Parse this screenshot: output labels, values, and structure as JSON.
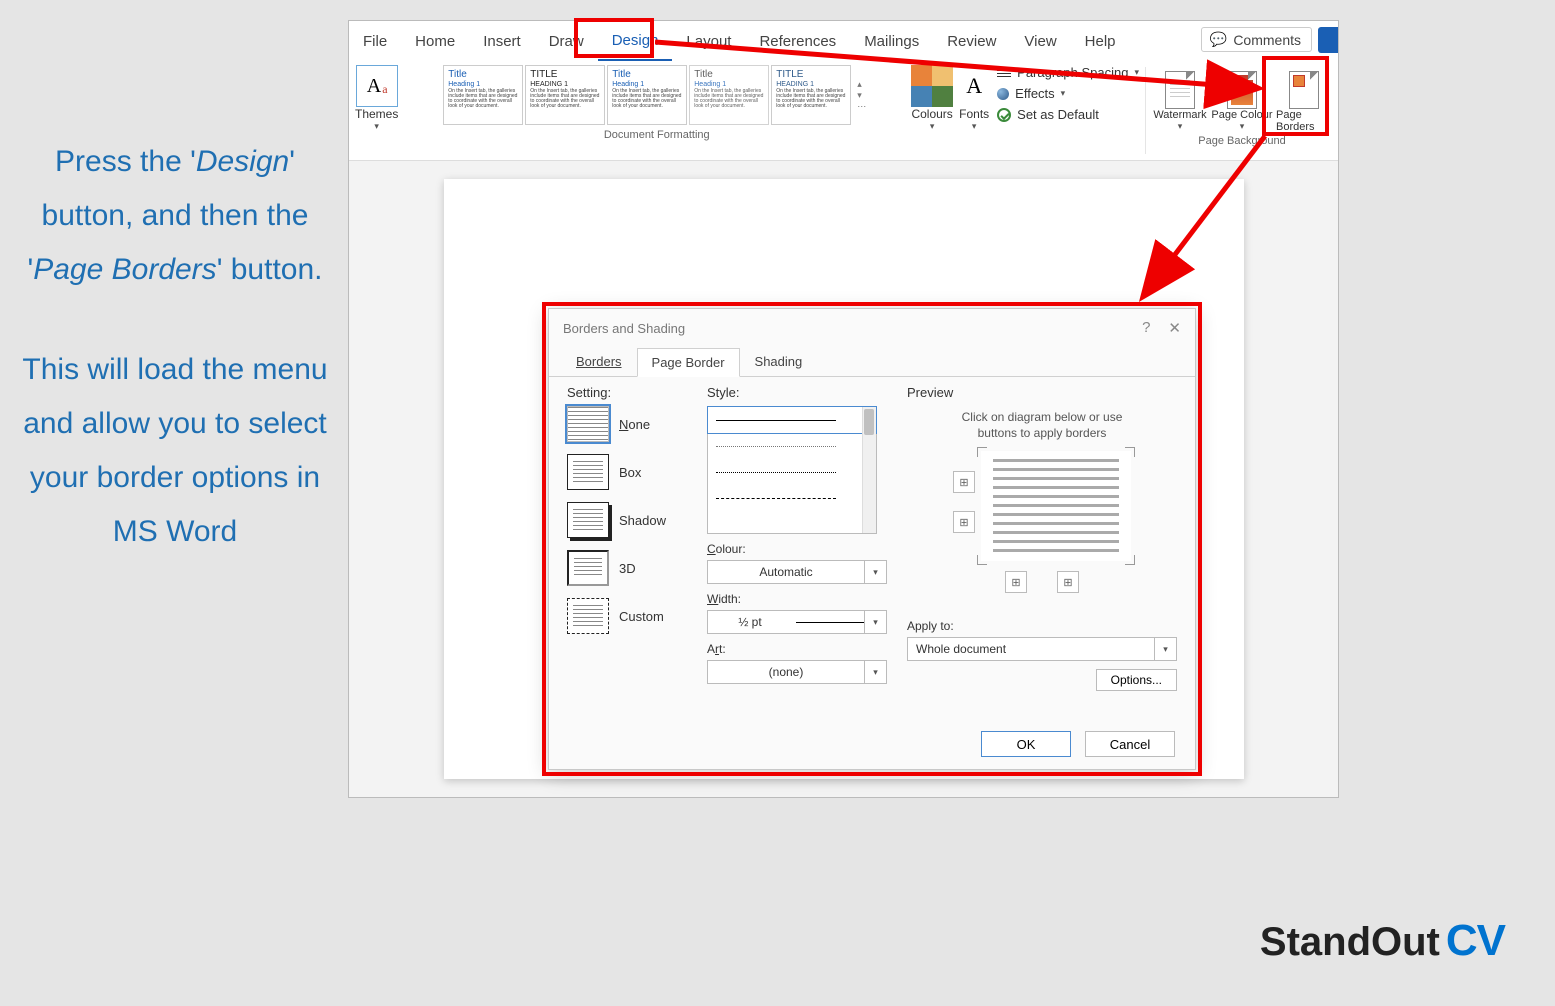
{
  "instructions": {
    "line1_pre": "Press the '",
    "line1_italic": "Design",
    "line1_post": "' button, and then the '",
    "line2_italic": "Page Borders",
    "line2_post": "' button.",
    "para2": "This will load the menu and allow you to select your border options in MS Word"
  },
  "tabs": [
    "File",
    "Home",
    "Insert",
    "Draw",
    "Design",
    "Layout",
    "References",
    "Mailings",
    "Review",
    "View",
    "Help"
  ],
  "active_tab": "Design",
  "comments": "Comments",
  "ribbon": {
    "themes": "Themes",
    "doc_formatting": "Document Formatting",
    "page_background": "Page Background",
    "preview_title": "Title",
    "preview_heading": "Heading 1",
    "preview_body": "On the Insert tab, the galleries include items that are designed to coordinate with the overall look of your document.",
    "colours": "Colours",
    "fonts": "Fonts",
    "para_spacing": "Paragraph Spacing",
    "effects": "Effects",
    "set_default": "Set as Default",
    "watermark": "Watermark",
    "page_colour": "Page Colour",
    "page_borders": "Page Borders"
  },
  "dialog": {
    "title": "Borders and Shading",
    "tabs": [
      "Borders",
      "Page Border",
      "Shading"
    ],
    "active_tab": "Page Border",
    "setting_label": "Setting:",
    "settings": [
      "None",
      "Box",
      "Shadow",
      "3D",
      "Custom"
    ],
    "style_label": "Style:",
    "colour_label": "Colour:",
    "colour_value": "Automatic",
    "width_label": "Width:",
    "width_value": "½ pt",
    "art_label": "Art:",
    "art_value": "(none)",
    "preview_label": "Preview",
    "preview_hint": "Click on diagram below or use buttons to apply borders",
    "apply_label": "Apply to:",
    "apply_value": "Whole document",
    "options": "Options...",
    "ok": "OK",
    "cancel": "Cancel"
  },
  "logo": {
    "a": "StandOut",
    "b": "CV"
  }
}
